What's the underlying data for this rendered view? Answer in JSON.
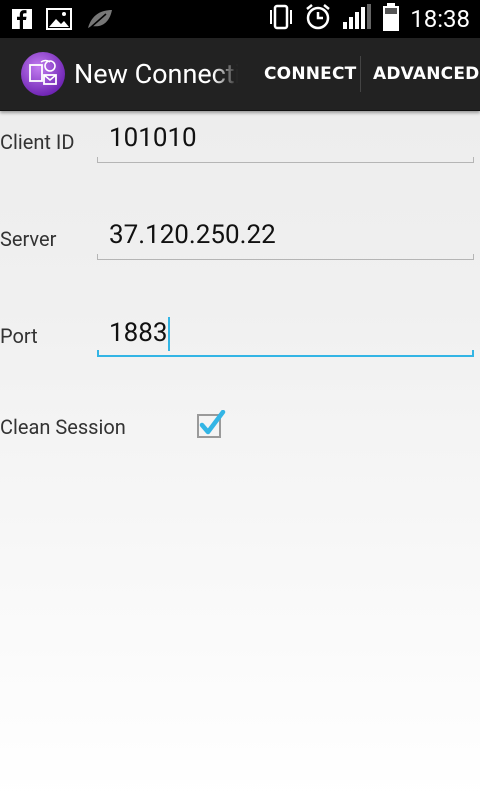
{
  "status_bar": {
    "time": "18:38",
    "left_icons": [
      "facebook-icon",
      "gallery-icon",
      "leaf-icon"
    ],
    "right_icons": [
      "vibrate-icon",
      "alarm-icon",
      "signal-icon",
      "battery-icon"
    ]
  },
  "action_bar": {
    "title": "New Connecti",
    "connect_label": "CONNECT",
    "advanced_label": "ADVANCED",
    "background": "#222222"
  },
  "form": {
    "client_id": {
      "label": "Client ID",
      "value": "101010"
    },
    "server": {
      "label": "Server",
      "value": "37.120.250.22"
    },
    "port": {
      "label": "Port",
      "value": "1883",
      "focused": true
    },
    "clean_session": {
      "label": "Clean Session",
      "checked": true
    }
  },
  "accent_color": "#33b5e5"
}
